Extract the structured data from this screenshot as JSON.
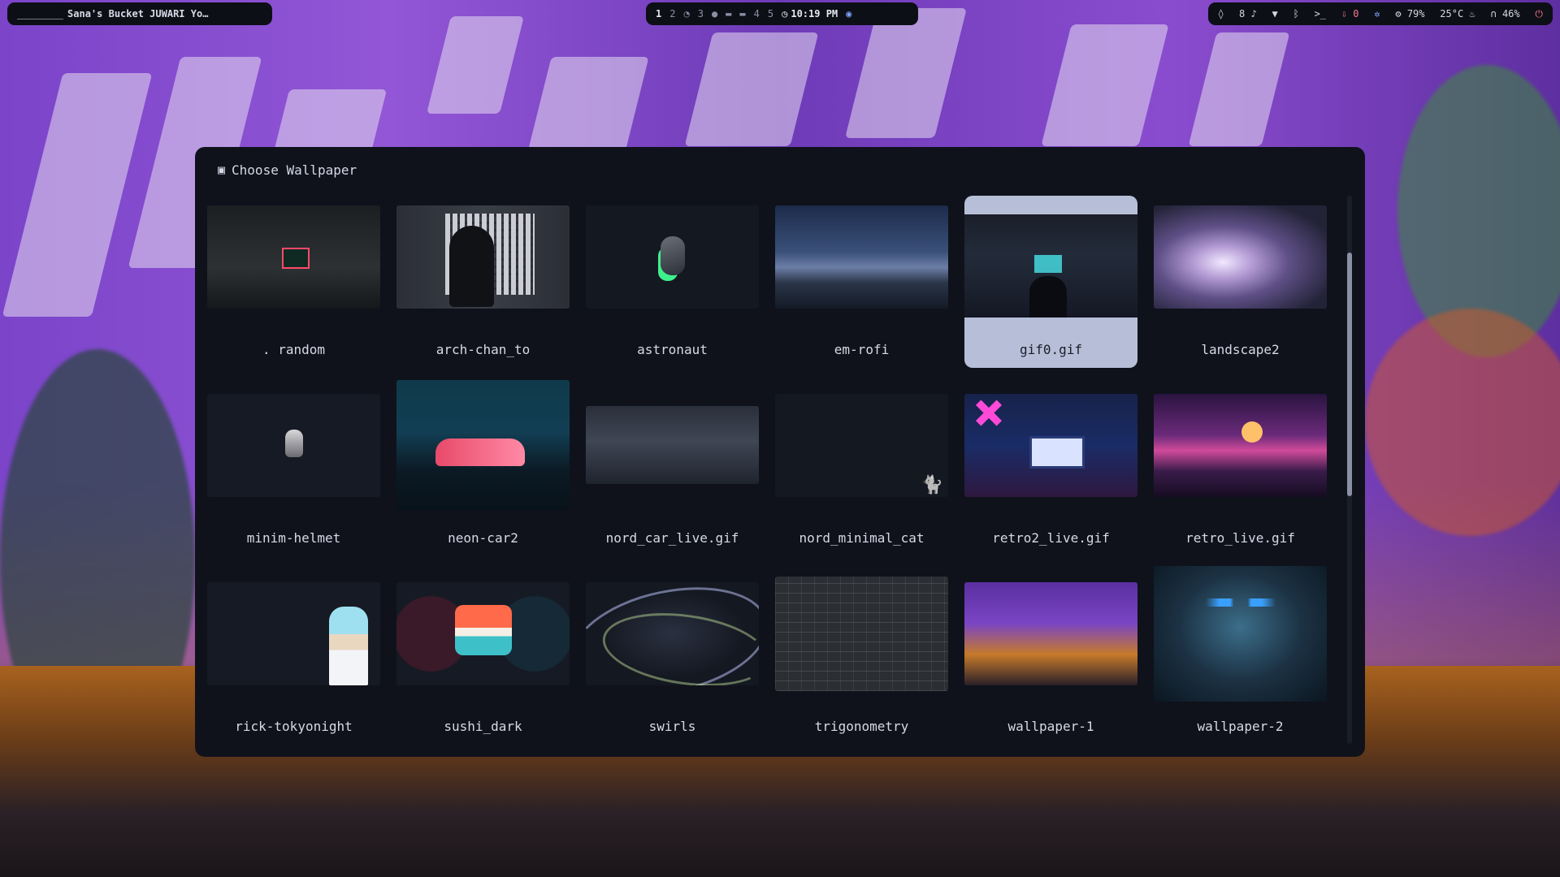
{
  "topbar": {
    "left": {
      "workspace_line": "_________",
      "window_title": "Sana's Bucket  JUWARI Yo…"
    },
    "center": {
      "workspaces": [
        "1",
        "2",
        "3",
        "4",
        "5"
      ],
      "active_workspace": "1",
      "clock": "10:19 PM"
    },
    "right": {
      "notifications_count": "8",
      "download_count": "0",
      "cpu": "79%",
      "temperature": "25°C",
      "headphone_battery": "46%"
    }
  },
  "dialog": {
    "title": "Choose Wallpaper",
    "selected": "gif0.gif",
    "items": [
      {
        "label": ". random"
      },
      {
        "label": "arch-chan_to"
      },
      {
        "label": "astronaut"
      },
      {
        "label": "em-rofi"
      },
      {
        "label": "gif0.gif"
      },
      {
        "label": "landscape2"
      },
      {
        "label": "minim-helmet"
      },
      {
        "label": "neon-car2"
      },
      {
        "label": "nord_car_live.gif"
      },
      {
        "label": "nord_minimal_cat"
      },
      {
        "label": "retro2_live.gif"
      },
      {
        "label": "retro_live.gif"
      },
      {
        "label": "rick-tokyonight"
      },
      {
        "label": "sushi_dark"
      },
      {
        "label": "swirls"
      },
      {
        "label": "trigonometry"
      },
      {
        "label": "wallpaper-1"
      },
      {
        "label": "wallpaper-2"
      }
    ]
  },
  "colors": {
    "dialog_bg": "#0f121b",
    "selected_bg": "#b7bfd8",
    "text": "#d6d9e6",
    "accent_blue": "#7aa2f7",
    "accent_red": "#f7768e"
  }
}
